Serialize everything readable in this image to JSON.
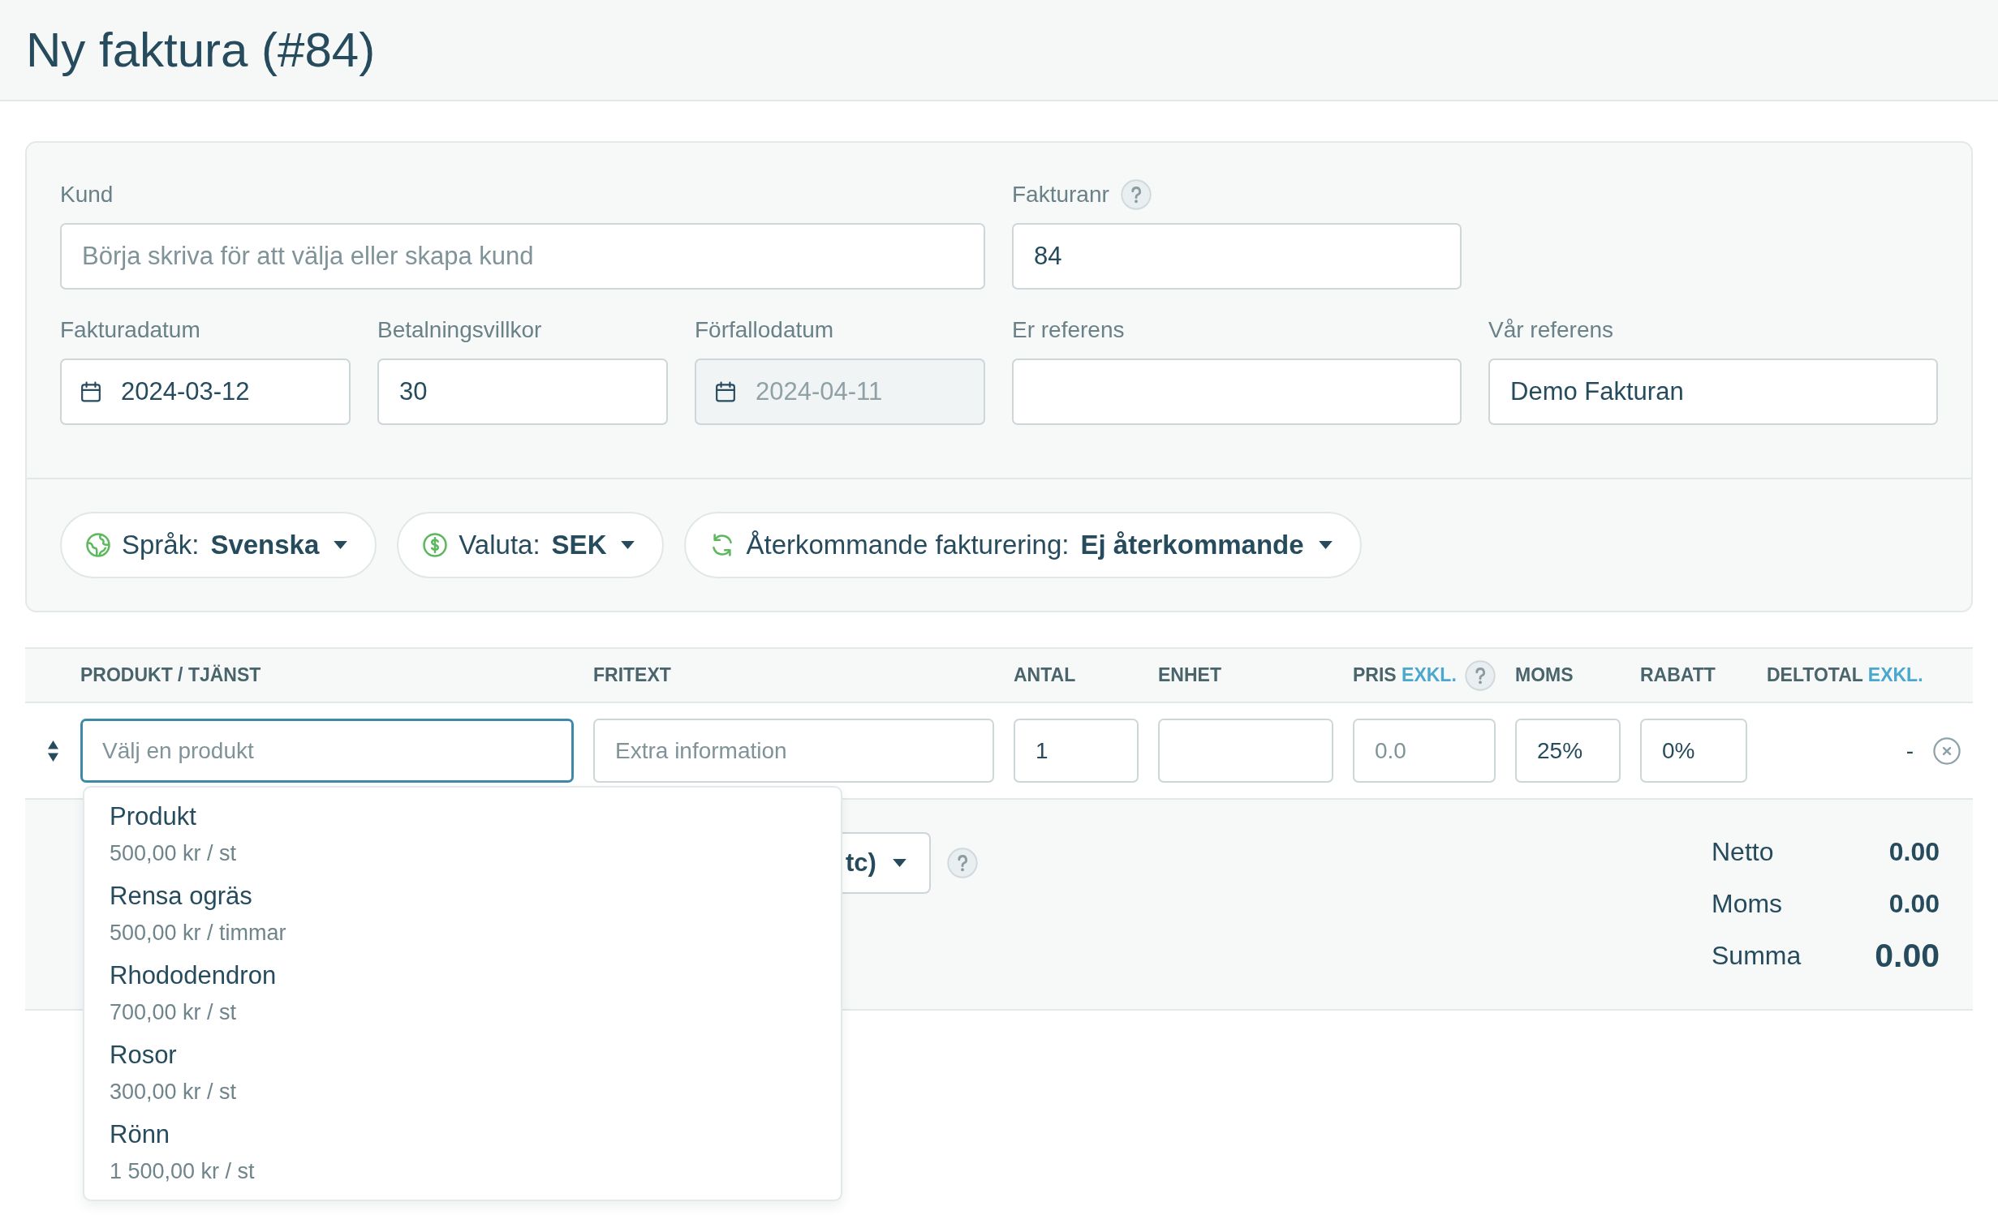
{
  "header": {
    "title": "Ny faktura (#84)"
  },
  "form": {
    "rows": [
      {
        "fields": [
          {
            "kind": "text",
            "label": "Kund",
            "placeholder": "Börja skriva för att välja eller skapa kund",
            "disabled": false
          },
          {
            "kind": "text",
            "label": "Fakturanr",
            "help": true,
            "value": "84",
            "disabled": false
          }
        ]
      },
      {
        "fields": [
          {
            "kind": "date",
            "label": "Fakturadatum",
            "value": "2024-03-12",
            "disabled": false
          },
          {
            "kind": "text",
            "label": "Betalningsvillkor",
            "value": "30",
            "disabled": false
          },
          {
            "kind": "date",
            "label": "Förfallodatum",
            "value": "2024-04-11",
            "disabled": true
          },
          {
            "kind": "text",
            "label": "Er referens",
            "disabled": false
          },
          {
            "kind": "text",
            "label": "Vår referens",
            "value": "Demo Fakturan",
            "disabled": false
          }
        ]
      }
    ],
    "options": [
      {
        "label": "Språk:",
        "value": "Svenska"
      },
      {
        "label": "Valuta:",
        "value": "SEK"
      },
      {
        "label": "Återkommande fakturering:",
        "value": "Ej återkommande"
      }
    ]
  },
  "table": {
    "columns": [
      {
        "label": "PRODUKT / TJÄNST"
      },
      {
        "label": "FRITEXT"
      },
      {
        "label": "ANTAL"
      },
      {
        "label": "ENHET"
      },
      {
        "label": "PRIS",
        "note": "EXKL.",
        "help": true
      },
      {
        "label": "MOMS"
      },
      {
        "label": "RABATT"
      },
      {
        "label": "DELTOTAL",
        "note": "EXKL."
      }
    ],
    "rows": [
      {
        "cells": [
          {
            "kind": "input",
            "placeholder": "Välj en produkt",
            "focused": true
          },
          {
            "kind": "input",
            "placeholder": "Extra information",
            "focused": false
          },
          {
            "kind": "input",
            "value": "1",
            "focused": false
          },
          {
            "kind": "input",
            "focused": false
          },
          {
            "kind": "input",
            "placeholder": "0.0",
            "focused": false
          },
          {
            "kind": "input",
            "value": "25%",
            "focused": false
          },
          {
            "kind": "input",
            "value": "0%",
            "focused": false
          },
          {
            "kind": "text",
            "text": "-"
          }
        ],
        "suggestions": [
          {
            "name": "Produkt",
            "price": "500,00 kr / st"
          },
          {
            "name": "Rensa ogräs",
            "price": "500,00 kr / timmar"
          },
          {
            "name": "Rhododendron",
            "price": "700,00 kr / st"
          },
          {
            "name": "Rosor",
            "price": "300,00 kr / st"
          },
          {
            "name": "Rönn",
            "price": "1 500,00 kr / st"
          }
        ]
      }
    ]
  },
  "summary": {
    "button": {
      "label": "tc)"
    },
    "help": true,
    "totals": [
      {
        "kind": "line",
        "label": "Netto",
        "value": "0.00"
      },
      {
        "kind": "line",
        "label": "Moms",
        "value": "0.00"
      },
      {
        "kind": "total",
        "label": "Summa",
        "value": "0.00"
      }
    ]
  }
}
